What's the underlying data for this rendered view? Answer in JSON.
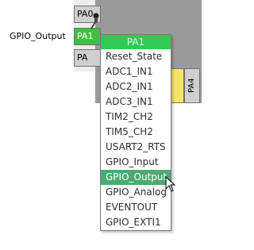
{
  "pins": {
    "top_label": "PA0-..",
    "active_label": "PA1",
    "active_signal": "GPIO_Output",
    "bottom_label": "PA",
    "vertical_label_1": "",
    "vertical_label_2": "PA4"
  },
  "context_menu": {
    "title": "PA1",
    "items": [
      {
        "label": "Reset_State"
      },
      {
        "label": "ADC1_IN1"
      },
      {
        "label": "ADC2_IN1"
      },
      {
        "label": "ADC3_IN1"
      },
      {
        "label": "TIM2_CH2"
      },
      {
        "label": "TIM5_CH2"
      },
      {
        "label": "USART2_RTS"
      },
      {
        "label": "GPIO_Input"
      },
      {
        "label": "GPIO_Output"
      },
      {
        "label": "GPIO_Analog"
      },
      {
        "label": "EVENTOUT"
      },
      {
        "label": "GPIO_EXTI1"
      }
    ],
    "selected_index": 8
  },
  "colors": {
    "menu_title_bg": "#2ecc52",
    "selected_bg": "#4fa873",
    "pin_active": "#40c040",
    "chip_body": "#9a9a9a"
  }
}
